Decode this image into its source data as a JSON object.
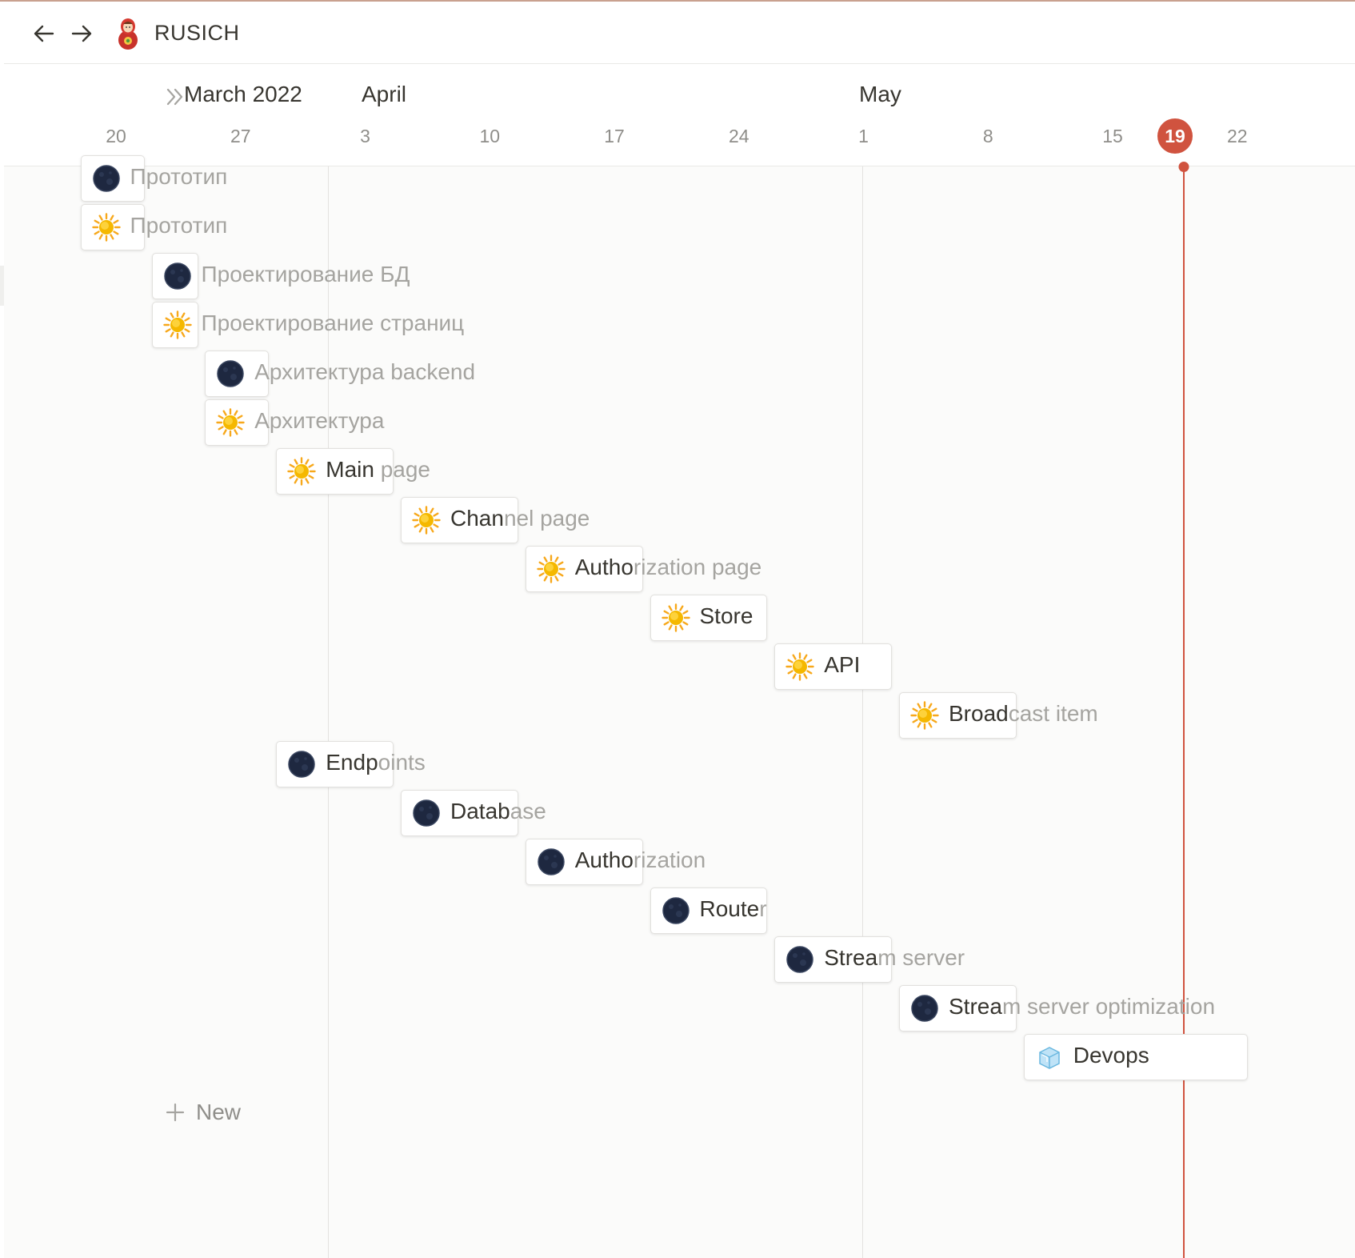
{
  "topbar": {
    "back_icon": "arrow-left-icon",
    "forward_icon": "arrow-right-icon",
    "page_icon": "matryoshka-doll-icon",
    "title": "RUSICH"
  },
  "timeline": {
    "expand_icon": "double-chevron-right-icon",
    "months": [
      {
        "label": "March 2022",
        "date": "2022-03"
      },
      {
        "label": "April",
        "date": "2022-04"
      },
      {
        "label": "May",
        "date": "2022-05"
      }
    ],
    "days": [
      {
        "label": "20",
        "date": "2022-03-20"
      },
      {
        "label": "27",
        "date": "2022-03-27"
      },
      {
        "label": "3",
        "date": "2022-04-03"
      },
      {
        "label": "10",
        "date": "2022-04-10"
      },
      {
        "label": "17",
        "date": "2022-04-17"
      },
      {
        "label": "24",
        "date": "2022-04-24"
      },
      {
        "label": "1",
        "date": "2022-05-01"
      },
      {
        "label": "8",
        "date": "2022-05-08"
      },
      {
        "label": "15",
        "date": "2022-05-15"
      },
      {
        "label": "22",
        "date": "2022-05-22"
      }
    ],
    "today": {
      "label": "19",
      "date": "2022-05-19",
      "color": "#d0533f"
    },
    "icon_colors": {
      "moon": "#1e2840",
      "sun": "#f5b800"
    }
  },
  "tasks": [
    {
      "name": "Прототип",
      "icon": "new-moon-icon",
      "start": "2022-03-18",
      "end": "2022-03-21"
    },
    {
      "name": "Прототип",
      "icon": "sun-icon",
      "start": "2022-03-18",
      "end": "2022-03-21"
    },
    {
      "name": "Проектирование БД",
      "icon": "new-moon-icon",
      "start": "2022-03-22",
      "end": "2022-03-24"
    },
    {
      "name": "Проектирование страниц",
      "icon": "sun-icon",
      "start": "2022-03-22",
      "end": "2022-03-24"
    },
    {
      "name": "Архитектура backend",
      "icon": "new-moon-icon",
      "start": "2022-03-25",
      "end": "2022-03-28"
    },
    {
      "name": "Архитектура",
      "icon": "sun-icon",
      "start": "2022-03-25",
      "end": "2022-03-28"
    },
    {
      "name": "Main page",
      "icon": "sun-icon",
      "start": "2022-03-29",
      "end": "2022-04-04"
    },
    {
      "name": "Channel page",
      "icon": "sun-icon",
      "start": "2022-04-05",
      "end": "2022-04-11"
    },
    {
      "name": "Authorization page",
      "icon": "sun-icon",
      "start": "2022-04-12",
      "end": "2022-04-18"
    },
    {
      "name": "Store",
      "icon": "sun-icon",
      "start": "2022-04-19",
      "end": "2022-04-25"
    },
    {
      "name": "API",
      "icon": "sun-icon",
      "start": "2022-04-26",
      "end": "2022-05-02"
    },
    {
      "name": "Broadcast item",
      "icon": "sun-icon",
      "start": "2022-05-03",
      "end": "2022-05-09"
    },
    {
      "name": "Endpoints",
      "icon": "new-moon-icon",
      "start": "2022-03-29",
      "end": "2022-04-04"
    },
    {
      "name": "Database",
      "icon": "new-moon-icon",
      "start": "2022-04-05",
      "end": "2022-04-11"
    },
    {
      "name": "Authorization",
      "icon": "new-moon-icon",
      "start": "2022-04-12",
      "end": "2022-04-18"
    },
    {
      "name": "Router",
      "icon": "new-moon-icon",
      "start": "2022-04-19",
      "end": "2022-04-25"
    },
    {
      "name": "Stream server",
      "icon": "new-moon-icon",
      "start": "2022-04-26",
      "end": "2022-05-02"
    },
    {
      "name": "Stream server optimization",
      "icon": "new-moon-icon",
      "start": "2022-05-03",
      "end": "2022-05-09"
    },
    {
      "name": "Devops",
      "icon": "ice-cube-icon",
      "start": "2022-05-10",
      "end": "2022-05-22"
    }
  ],
  "new_button": {
    "label": "New",
    "icon": "plus-icon"
  }
}
